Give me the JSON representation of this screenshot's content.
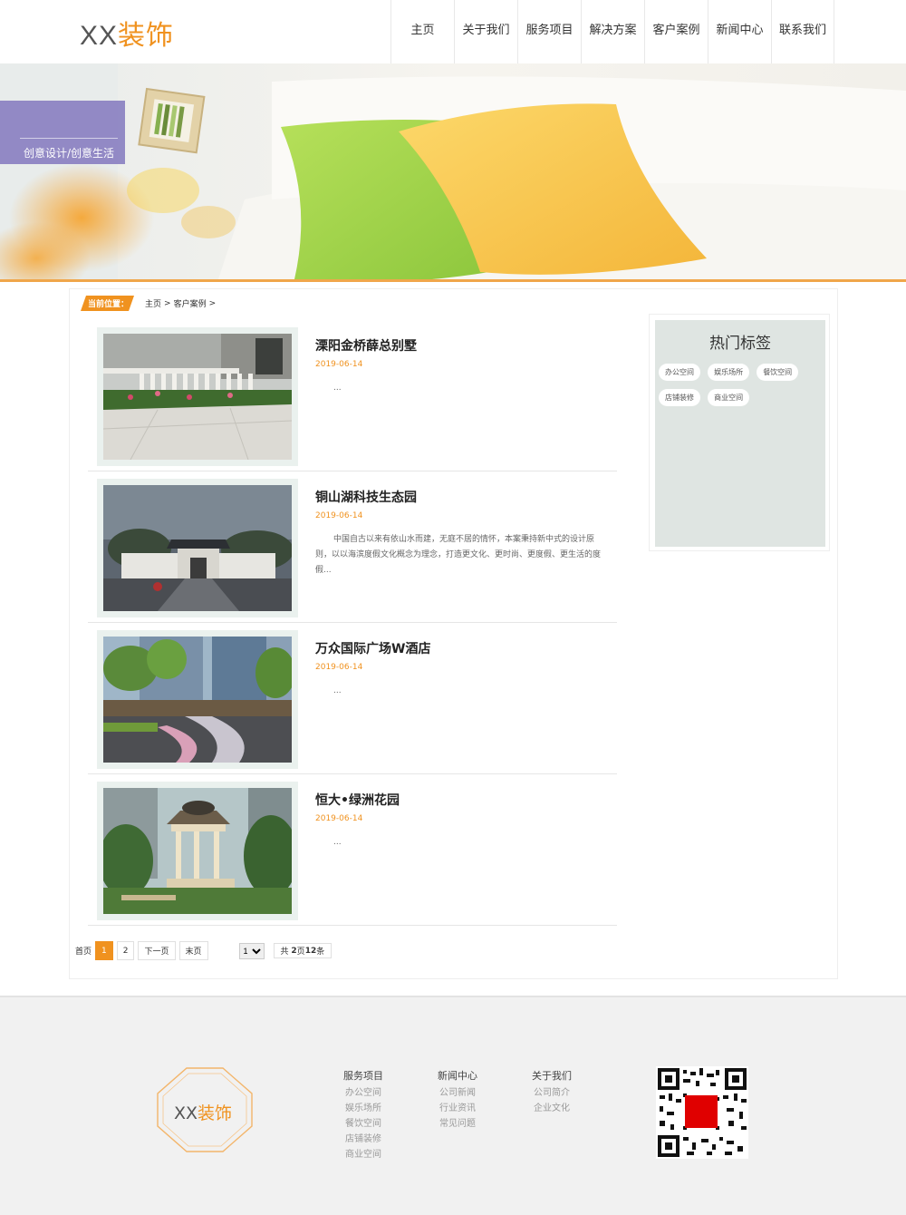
{
  "header": {
    "logo_part1": "XX",
    "logo_part2": "装饰",
    "nav": [
      "主页",
      "关于我们",
      "服务项目",
      "解决方案",
      "客户案例",
      "新闻中心",
      "联系我们"
    ]
  },
  "banner": {
    "tagline": "创意设计/创意生活"
  },
  "breadcrumb": {
    "label": "当前位置：",
    "home": "主页",
    "sep1": ">",
    "current": "客户案例",
    "sep2": ">"
  },
  "cases": [
    {
      "title": "溧阳金桥薛总别墅",
      "date": "2019-06-14",
      "desc": "..."
    },
    {
      "title": "铜山湖科技生态园",
      "date": "2019-06-14",
      "desc": "中国自古以来有依山水而建，无庭不居的情怀，本案秉持新中式的设计原则，以以海滨度假文化概念为理念，打造更文化、更时尚、更度假、更生活的度假..."
    },
    {
      "title": "万众国际广场W酒店",
      "date": "2019-06-14",
      "desc": "..."
    },
    {
      "title": "恒大•绿洲花园",
      "date": "2019-06-14",
      "desc": "..."
    }
  ],
  "pager": {
    "first": "首页",
    "pages": [
      "1",
      "2"
    ],
    "next": "下一页",
    "last": "末页",
    "select_value": "1",
    "total_prefix": "共",
    "total_pages": "2",
    "total_mid": "页",
    "total_items": "12",
    "total_suffix": "条"
  },
  "sidebar": {
    "title": "热门标签",
    "tags": [
      "办公空间",
      "娱乐场所",
      "餐饮空间",
      "店铺装修",
      "商业空间"
    ]
  },
  "footer": {
    "logo_part1": "XX",
    "logo_part2": "装饰",
    "columns": [
      {
        "heading": "服务项目",
        "links": [
          "办公空间",
          "娱乐场所",
          "餐饮空间",
          "店铺装修",
          "商业空间"
        ]
      },
      {
        "heading": "新闻中心",
        "links": [
          "公司新闻",
          "行业资讯",
          "常见问题"
        ]
      },
      {
        "heading": "关于我们",
        "links": [
          "公司简介",
          "企业文化"
        ]
      }
    ]
  },
  "colors": {
    "accent": "#f0921f",
    "banner_tag": "#8278be",
    "sidebar_bg": "#dfe5e2",
    "qr_center": "#e00000"
  }
}
